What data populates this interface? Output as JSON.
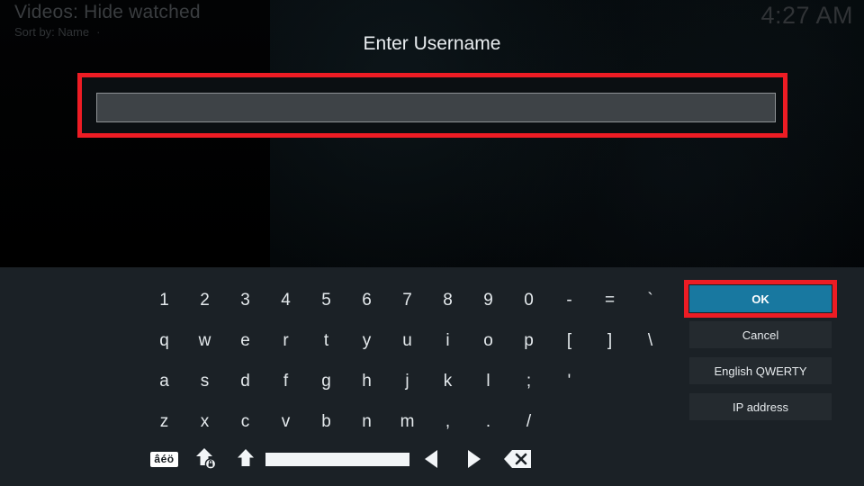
{
  "topbar": {
    "breadcrumb_title": "Videos: Hide watched",
    "sort_label": "Sort by: Name",
    "sort_dot": "·",
    "clock": "4:27 AM"
  },
  "dialog": {
    "title": "Enter Username",
    "input_value": "",
    "input_placeholder": ""
  },
  "keyboard": {
    "rows": [
      [
        "1",
        "2",
        "3",
        "4",
        "5",
        "6",
        "7",
        "8",
        "9",
        "0",
        "-",
        "=",
        "`"
      ],
      [
        "q",
        "w",
        "e",
        "r",
        "t",
        "y",
        "u",
        "i",
        "o",
        "p",
        "[",
        "]",
        "\\"
      ],
      [
        "a",
        "s",
        "d",
        "f",
        "g",
        "h",
        "j",
        "k",
        "l",
        ";",
        "'"
      ],
      [
        "z",
        "x",
        "c",
        "v",
        "b",
        "n",
        "m",
        ",",
        ".",
        "/"
      ]
    ],
    "function_row": {
      "accents_label": "âéö",
      "capslock_name": "caps-lock-icon",
      "shift_name": "shift-icon",
      "space_name": "space-bar",
      "cursor_left_name": "cursor-left-icon",
      "cursor_right_name": "cursor-right-icon",
      "backspace_name": "backspace-icon"
    }
  },
  "side_buttons": [
    {
      "label": "OK",
      "focused": true
    },
    {
      "label": "Cancel",
      "focused": false
    },
    {
      "label": "English QWERTY",
      "focused": false
    },
    {
      "label": "IP address",
      "focused": false
    }
  ],
  "colors": {
    "accent_blue": "#1878a0",
    "annotation_red": "#ed1c24",
    "panel_bg": "#1b2126",
    "key_text": "#e4e9ec",
    "button_bg": "#242a2f",
    "input_fill": "#3e4347",
    "input_border": "#8e9295"
  }
}
